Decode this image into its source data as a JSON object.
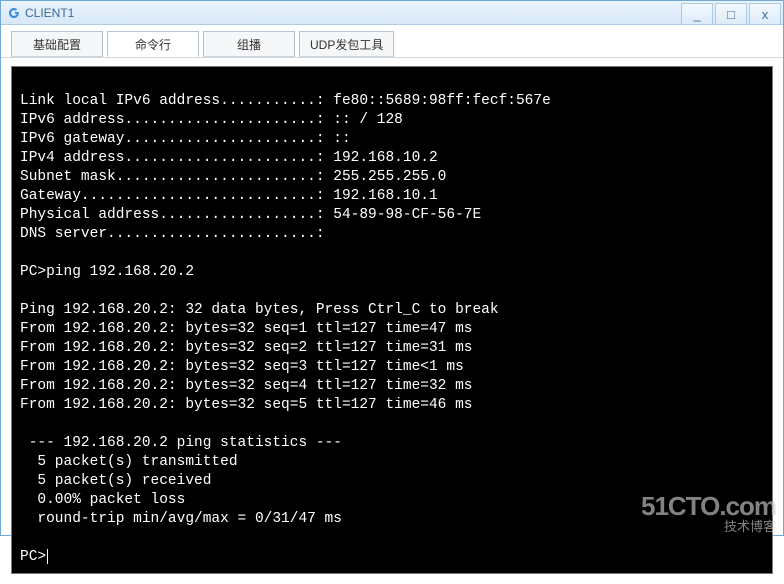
{
  "window": {
    "title": "CLIENT1",
    "min_label": "_",
    "max_label": "□",
    "close_label": "x"
  },
  "tabs": [
    {
      "label": "基础配置"
    },
    {
      "label": "命令行"
    },
    {
      "label": "组播"
    },
    {
      "label": "UDP发包工具"
    }
  ],
  "terminal": {
    "lines": [
      "",
      "Link local IPv6 address...........: fe80::5689:98ff:fecf:567e",
      "IPv6 address......................: :: / 128",
      "IPv6 gateway......................: ::",
      "IPv4 address......................: 192.168.10.2",
      "Subnet mask.......................: 255.255.255.0",
      "Gateway...........................: 192.168.10.1",
      "Physical address..................: 54-89-98-CF-56-7E",
      "DNS server........................:",
      "",
      "PC>ping 192.168.20.2",
      "",
      "Ping 192.168.20.2: 32 data bytes, Press Ctrl_C to break",
      "From 192.168.20.2: bytes=32 seq=1 ttl=127 time=47 ms",
      "From 192.168.20.2: bytes=32 seq=2 ttl=127 time=31 ms",
      "From 192.168.20.2: bytes=32 seq=3 ttl=127 time<1 ms",
      "From 192.168.20.2: bytes=32 seq=4 ttl=127 time=32 ms",
      "From 192.168.20.2: bytes=32 seq=5 ttl=127 time=46 ms",
      "",
      " --- 192.168.20.2 ping statistics ---",
      "  5 packet(s) transmitted",
      "  5 packet(s) received",
      "  0.00% packet loss",
      "  round-trip min/avg/max = 0/31/47 ms",
      ""
    ],
    "prompt": "PC>"
  },
  "watermark": {
    "line1": "51CTO.com",
    "line2": "技术博客"
  }
}
